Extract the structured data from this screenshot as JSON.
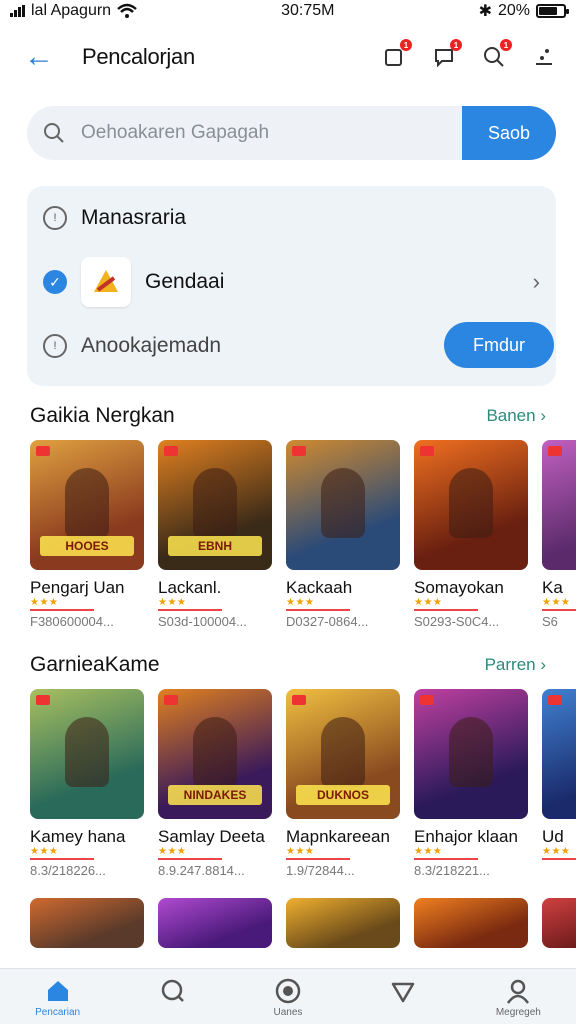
{
  "status": {
    "carrier": "lal Apagurn",
    "time": "30:75M",
    "battery": "20%",
    "battery_level": 0.7
  },
  "appbar": {
    "title": "Pencalorjan"
  },
  "search": {
    "placeholder": "Oehoakaren Gapagah",
    "button": "Saob"
  },
  "card": {
    "row1_label": "Manasraria",
    "row2_label": "Gendaai",
    "row3_label": "Anookajemadn",
    "find_button": "Fmdur"
  },
  "section1": {
    "title": "Gaikia Nergkan",
    "see_all": "Banen",
    "games": [
      {
        "name": "Pengarj Uan",
        "meta": "F380600004...",
        "banner": "HOOES",
        "bg": "#8a3a1e",
        "bg2": "#e0a040"
      },
      {
        "name": "Lackanl.",
        "meta": "S03d-100004...",
        "banner": "EBNH",
        "bg": "#3a2a18",
        "bg2": "#e08020"
      },
      {
        "name": "Kackaah",
        "meta": "D0327-0864...",
        "banner": "",
        "bg": "#2a4a78",
        "bg2": "#d08a30"
      },
      {
        "name": "Somayokan",
        "meta": "S0293-S0C4...",
        "banner": "",
        "bg": "#6a2010",
        "bg2": "#f07020"
      },
      {
        "name": "Ka",
        "meta": "S6",
        "banner": "",
        "bg": "#5a2a6a",
        "bg2": "#c060c0"
      }
    ]
  },
  "section2": {
    "title": "GarnieaKame",
    "see_all": "Parren",
    "games": [
      {
        "name": "Kamey hana",
        "meta": "8.3/218226...",
        "banner": "",
        "bg": "#2a6a5a",
        "bg2": "#a8c060"
      },
      {
        "name": "Samlay Deeta",
        "meta": "8.9.247.8814...",
        "banner": "NINDAKES",
        "bg": "#3a1a5a",
        "bg2": "#e08020"
      },
      {
        "name": "Mapnkareean",
        "meta": "1.9/72844...",
        "banner": "DUKNOS",
        "bg": "#8a4a20",
        "bg2": "#f0c040"
      },
      {
        "name": "Enhajor klaan",
        "meta": "8.3/218221...",
        "banner": "",
        "bg": "#2a1a5a",
        "bg2": "#c040a0"
      },
      {
        "name": "Ud",
        "meta": "",
        "banner": "",
        "bg": "#1a2a6a",
        "bg2": "#4080d0"
      }
    ]
  },
  "section3": {
    "thumbs": [
      {
        "bg": "#5a3a2a",
        "bg2": "#d06a30"
      },
      {
        "bg": "#4a1a7a",
        "bg2": "#b04ad0"
      },
      {
        "bg": "#6a4a1a",
        "bg2": "#f0b030"
      },
      {
        "bg": "#7a2a10",
        "bg2": "#f08020"
      },
      {
        "bg": "#6a1a1a",
        "bg2": "#d04040"
      }
    ]
  },
  "nav": {
    "items": [
      {
        "label": "Pencarian"
      },
      {
        "label": ""
      },
      {
        "label": "Uanes"
      },
      {
        "label": ""
      },
      {
        "label": "Megregeh"
      }
    ]
  }
}
